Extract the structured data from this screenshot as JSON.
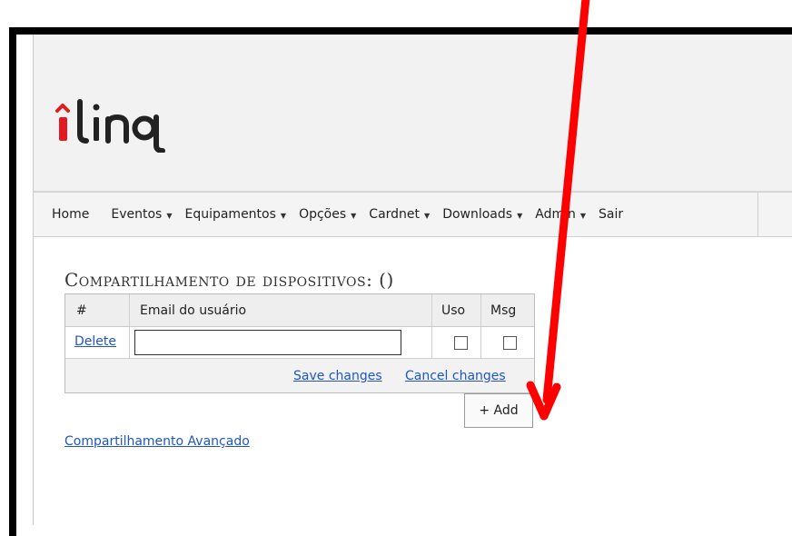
{
  "header": {
    "logo_text": "iling"
  },
  "nav": {
    "items": [
      {
        "label": "Home",
        "dropdown": false
      },
      {
        "label": "Eventos",
        "dropdown": true
      },
      {
        "label": "Equipamentos",
        "dropdown": true
      },
      {
        "label": "Opções",
        "dropdown": true
      },
      {
        "label": "Cardnet",
        "dropdown": true
      },
      {
        "label": "Downloads",
        "dropdown": true
      },
      {
        "label": "Admin",
        "dropdown": true
      },
      {
        "label": "Sair",
        "dropdown": false
      }
    ]
  },
  "main": {
    "title": "Compartilhamento de dispositivos: ()",
    "grid": {
      "columns": [
        "#",
        "Email do usuário",
        "Uso",
        "Msg"
      ],
      "row": {
        "delete_label": "Delete",
        "email_value": "",
        "uso_checked": false,
        "msg_checked": false
      },
      "save_label": "Save changes",
      "cancel_label": "Cancel changes"
    },
    "add_label": "+ Add",
    "advanced_link": "Compartilhamento Avançado"
  },
  "colors": {
    "logo_red": "#e01b22",
    "link_blue": "#1f55c8",
    "annotation_arrow": "#ff0000"
  }
}
